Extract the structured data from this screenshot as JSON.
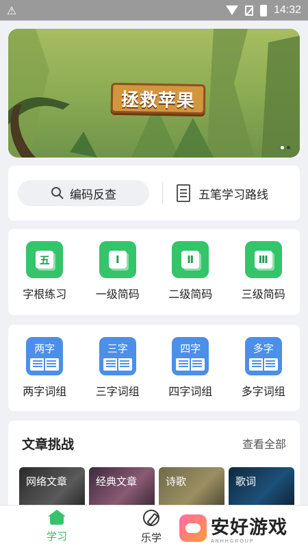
{
  "status_bar": {
    "time": "14:32"
  },
  "banner": {
    "sign_text": "拯救苹果"
  },
  "search": {
    "lookup_label": "编码反查",
    "route_label": "五笔学习路线"
  },
  "level_grid": [
    {
      "icon_char": "五",
      "label": "字根练习"
    },
    {
      "icon_char": "Ⅰ",
      "label": "一级简码"
    },
    {
      "icon_char": "Ⅱ",
      "label": "二级简码"
    },
    {
      "icon_char": "Ⅲ",
      "label": "三级简码"
    }
  ],
  "word_grid": [
    {
      "icon_char": "两字",
      "label": "两字词组"
    },
    {
      "icon_char": "三字",
      "label": "三字词组"
    },
    {
      "icon_char": "四字",
      "label": "四字词组"
    },
    {
      "icon_char": "多字",
      "label": "多字词组"
    }
  ],
  "articles": {
    "title": "文章挑战",
    "see_all": "查看全部",
    "items": [
      "网络文章",
      "经典文章",
      "诗歌",
      "歌词"
    ]
  },
  "bottom_nav": {
    "study": "学习",
    "fun": "乐学"
  },
  "watermark": {
    "text": "安好游戏",
    "sub": "ANHHGROUP"
  },
  "colors": {
    "accent_green": "#34c46a",
    "accent_blue": "#4b8fe8"
  }
}
